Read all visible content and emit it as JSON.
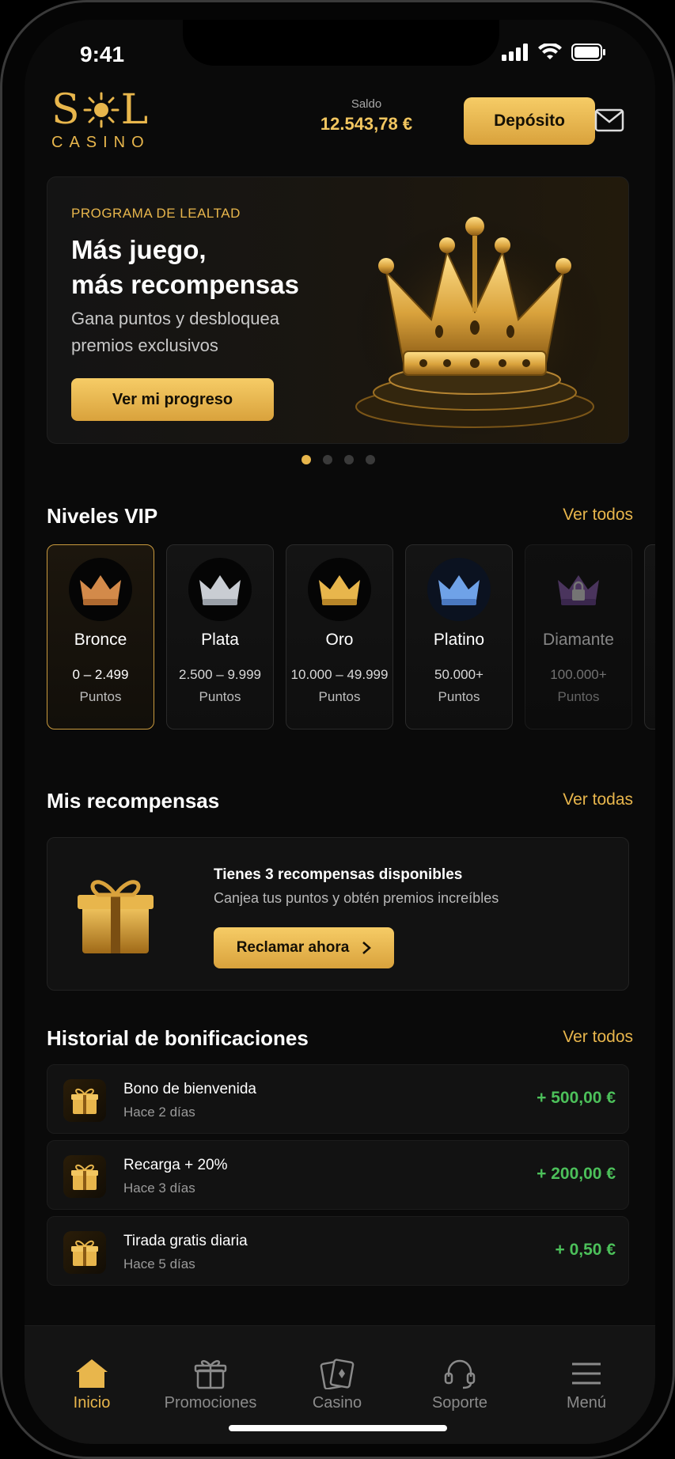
{
  "status_bar": {
    "time": "9:41"
  },
  "header": {
    "logo_top": "S",
    "logo_top_end": "L",
    "logo_bottom": "CASINO",
    "balance_label": "Saldo",
    "balance_value": "12.543,78 €",
    "deposit_label": "Depósito",
    "mail_icon": "mail-icon"
  },
  "hero": {
    "eyebrow": "PROGRAMA DE LEALTAD",
    "title_line1": "Más juego,",
    "title_line2": "más recompensas",
    "subtitle": "Gana puntos y desbloquea premios exclusivos",
    "button_label": "Ver mi progreso",
    "carousel_pages": 4,
    "carousel_active": 1
  },
  "vip": {
    "title": "Niveles VIP",
    "link": "Ver todos",
    "levels": [
      {
        "name": "Bronce",
        "range": "0 – 2.499",
        "unit": "Puntos",
        "color": "#d38a4a",
        "icon": "bronze-crown-icon"
      },
      {
        "name": "Plata",
        "range": "2.500 – 9.999",
        "unit": "Puntos",
        "color": "#c9cdd3",
        "icon": "silver-crown-icon"
      },
      {
        "name": "Oro",
        "range": "10.000 – 49.999",
        "unit": "Puntos",
        "color": "#e8b64c",
        "icon": "gold-crown-icon"
      },
      {
        "name": "Platino",
        "range": "50.000+",
        "unit": "Puntos",
        "color": "#6fa2e8",
        "icon": "platinum-crown-icon"
      },
      {
        "name": "Diamante",
        "range": "100.000+",
        "unit": "Puntos",
        "color": "#8a5fb0",
        "icon": "locked-crown-icon"
      }
    ]
  },
  "rewards": {
    "title": "Mis recompensas",
    "link": "Ver todas",
    "card_title": "Tienes 3 recompensas disponibles",
    "card_subtitle": "Canjea tus puntos y obtén premios increíbles",
    "button_label": "Reclamar ahora"
  },
  "history": {
    "title": "Historial de bonificaciones",
    "link": "Ver todos",
    "items": [
      {
        "title": "Bono de bienvenida",
        "date": "Hace 2 días",
        "amount": "+ 500,00 €"
      },
      {
        "title": "Recarga + 20%",
        "date": "Hace 3 días",
        "amount": "+ 200,00 €"
      },
      {
        "title": "Tirada gratis diaria",
        "date": "Hace 5 días",
        "amount": "+ 0,50 €"
      }
    ]
  },
  "nav": {
    "items": [
      {
        "label": "Inicio",
        "icon": "home-icon"
      },
      {
        "label": "Promociones",
        "icon": "gift-icon"
      },
      {
        "label": "Casino",
        "icon": "cards-icon"
      },
      {
        "label": "Soporte",
        "icon": "headset-icon"
      },
      {
        "label": "Menú",
        "icon": "menu-icon"
      }
    ],
    "active_index": 0
  },
  "colors": {
    "accent": "#e8b64c",
    "positive": "#4cc05a",
    "background": "#0a0a0a"
  }
}
